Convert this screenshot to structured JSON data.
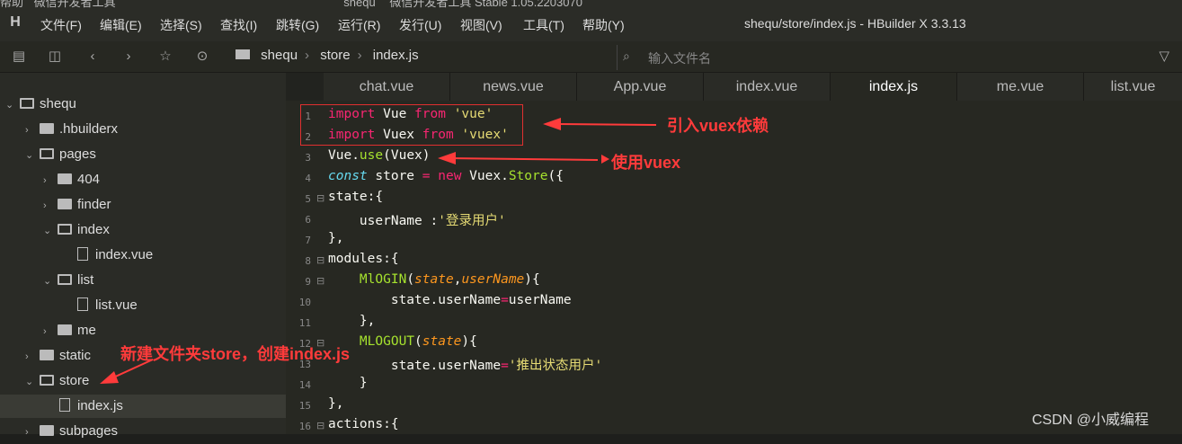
{
  "background_window": {
    "items": [
      "帮助",
      "微信开发者工具",
      "shequ",
      "微信开发者工具 Stable 1.05.2203070"
    ]
  },
  "menu": [
    "文件(F)",
    "编辑(E)",
    "选择(S)",
    "查找(I)",
    "跳转(G)",
    "运行(R)",
    "发行(U)",
    "视图(V)",
    "工具(T)",
    "帮助(Y)"
  ],
  "window_title": "shequ/store/index.js - HBuilder X 3.3.13",
  "breadcrumb": [
    "shequ",
    "store",
    "index.js"
  ],
  "file_search": {
    "placeholder": "输入文件名"
  },
  "tree": [
    {
      "label": "shequ",
      "kind": "folder-open",
      "expanded": true
    },
    {
      "label": ".hbuilderx",
      "kind": "folder"
    },
    {
      "label": "pages",
      "kind": "folder-open",
      "expanded": true
    },
    {
      "label": "404",
      "kind": "folder"
    },
    {
      "label": "finder",
      "kind": "folder"
    },
    {
      "label": "index",
      "kind": "folder-open",
      "expanded": true
    },
    {
      "label": "index.vue",
      "kind": "file"
    },
    {
      "label": "list",
      "kind": "folder-open",
      "expanded": true
    },
    {
      "label": "list.vue",
      "kind": "file"
    },
    {
      "label": "me",
      "kind": "folder"
    },
    {
      "label": "static",
      "kind": "folder"
    },
    {
      "label": "store",
      "kind": "folder-open",
      "expanded": true
    },
    {
      "label": "index.js",
      "kind": "file",
      "selected": true
    },
    {
      "label": "subpages",
      "kind": "folder"
    }
  ],
  "tabs": [
    "chat.vue",
    "news.vue",
    "App.vue",
    "index.vue",
    "index.js",
    "me.vue",
    "list.vue"
  ],
  "active_tab": "index.js",
  "line_numbers": [
    "1",
    "2",
    "3",
    "4",
    "5",
    "6",
    "7",
    "8",
    "9",
    "10",
    "11",
    "12",
    "13",
    "14",
    "15",
    "16"
  ],
  "code_tokens": {
    "l1": [
      "import",
      " Vue ",
      "from",
      " 'vue'"
    ],
    "l2": [
      "import",
      " Vuex ",
      "from",
      " 'vuex'"
    ],
    "l3": [
      "Vue.",
      "use",
      "(Vuex)"
    ],
    "l4": [
      "const",
      " store ",
      "=",
      " ",
      "new",
      " Vuex.",
      "Store",
      "({"
    ],
    "l5": [
      "state:{"
    ],
    "l6": [
      "    userName :",
      "'登录用户'"
    ],
    "l7": [
      "},"
    ],
    "l8": [
      "modules:{"
    ],
    "l9": [
      "    ",
      "MlOGIN",
      "(",
      "state",
      ",",
      "userName",
      "){"
    ],
    "l10": [
      "        state.userName",
      "=",
      "userName"
    ],
    "l11": [
      "    },"
    ],
    "l12": [
      "    ",
      "MLOGOUT",
      "(",
      "state",
      "){"
    ],
    "l13": [
      "        state.userName",
      "=",
      "'推出状态用户'"
    ],
    "l14": [
      "    }"
    ],
    "l15": [
      "},"
    ],
    "l16": [
      "actions:{"
    ]
  },
  "annotations": {
    "import_vuex": "引入vuex依赖",
    "use_vuex": "使用vuex",
    "new_store": "新建文件夹store，创建index.js"
  },
  "watermark": "CSDN @小威编程",
  "colors": {
    "keyword": "#f92672",
    "string": "#e6db74",
    "function": "#a6e22e",
    "annotation": "#ff3b3b"
  }
}
